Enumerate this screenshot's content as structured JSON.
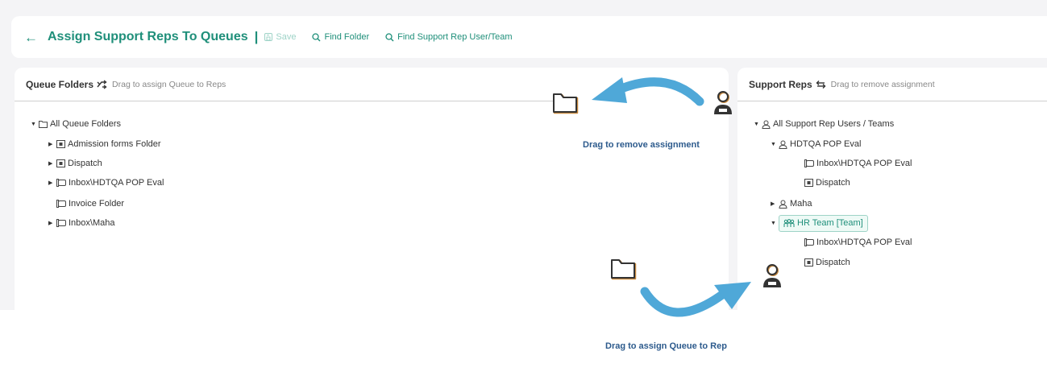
{
  "header": {
    "back_icon": "back-arrow-icon",
    "title": "Assign Support Reps To Queues",
    "separator": "|",
    "save_label": "Save",
    "find_folder_label": "Find Folder",
    "find_rep_label": "Find Support Rep User/Team"
  },
  "left_panel": {
    "title": "Queue Folders",
    "hint": "Drag to assign Queue to Reps",
    "tree": {
      "root": "All Queue Folders",
      "items": [
        "Admission forms Folder",
        "Dispatch",
        "Inbox\\HDTQA POP Eval",
        "Invoice Folder",
        "Inbox\\Maha"
      ]
    }
  },
  "right_panel": {
    "title": "Support Reps",
    "hint": "Drag to remove assignment",
    "tree": {
      "root": "All Support Rep Users / Teams",
      "user1": "HDTQA POP Eval",
      "user1_children": [
        "Inbox\\HDTQA POP Eval",
        "Dispatch"
      ],
      "user2": "Maha",
      "team": "HR Team [Team]",
      "team_children": [
        "Inbox\\HDTQA POP Eval",
        "Dispatch"
      ]
    }
  },
  "annotations": {
    "remove_label": "Drag to remove assignment",
    "assign_label": "Drag to assign Queue to Rep"
  },
  "colors": {
    "accent": "#1f8f7a",
    "arrow": "#4fa8d8",
    "annotation_text": "#2c5a8c"
  }
}
